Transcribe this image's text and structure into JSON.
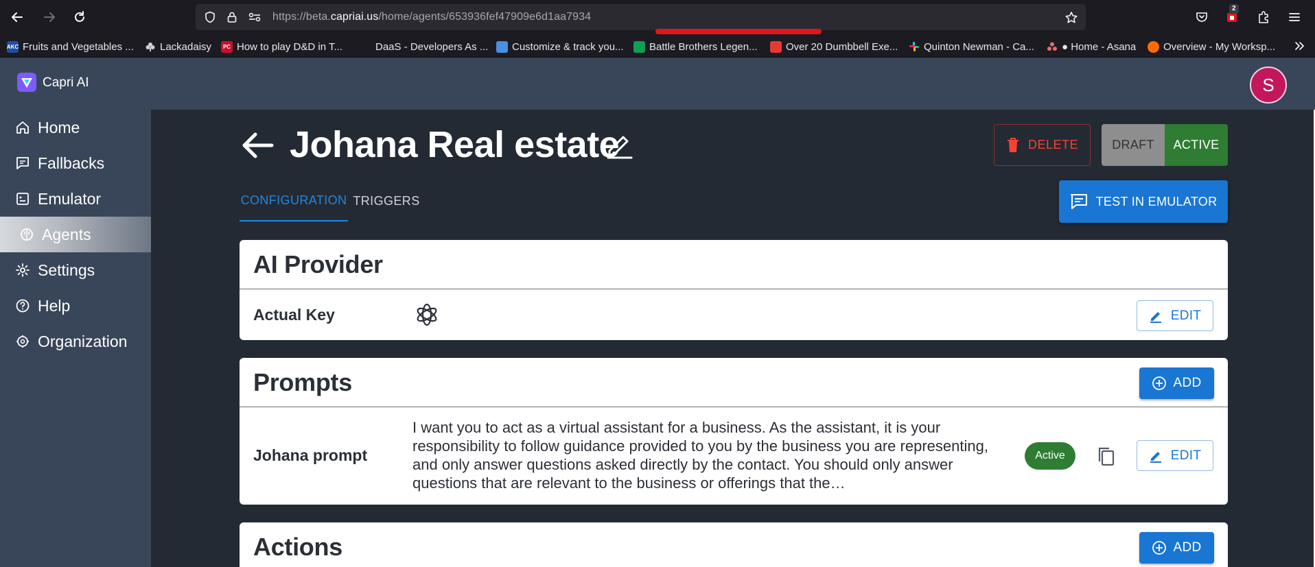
{
  "browser": {
    "url_prefix": "https://beta.",
    "url_host": "capriai.us",
    "url_path": "/home/agents/653936fef47909e6d1aa7934",
    "extension_badge": "2",
    "bookmarks": [
      {
        "label": "Fruits and Vegetables ...",
        "fav": "AKC",
        "color": "#1f4fa3"
      },
      {
        "label": "Lackadaisy",
        "fav": "",
        "color": "#1c1b22"
      },
      {
        "label": "How to play D&D in T...",
        "fav": "PC",
        "color": "#c8102e"
      },
      {
        "label": "DaaS - Developers As ...",
        "fav": "",
        "color": "#1c1b22"
      },
      {
        "label": "Customize & track you...",
        "fav": "",
        "color": "#4a90e2"
      },
      {
        "label": "Battle Brothers Legen...",
        "fav": "",
        "color": "#0f9d58"
      },
      {
        "label": "Over 20 Dumbbell Exe...",
        "fav": "",
        "color": "#e53935"
      },
      {
        "label": "Quinton Newman - Ca...",
        "fav": "",
        "color": "#611f69"
      },
      {
        "label": "● Home - Asana",
        "fav": "",
        "color": "#1c1b22"
      },
      {
        "label": "Overview - My Worksp...",
        "fav": "",
        "color": "#ff6d00"
      }
    ]
  },
  "app": {
    "brand": "Capri AI",
    "avatar_initial": "S"
  },
  "sidebar": {
    "items": [
      {
        "label": "Home",
        "icon": "home-icon"
      },
      {
        "label": "Fallbacks",
        "icon": "chat-icon"
      },
      {
        "label": "Emulator",
        "icon": "robot-icon"
      },
      {
        "label": "Agents",
        "icon": "brain-icon"
      },
      {
        "label": "Settings",
        "icon": "gear-icon"
      },
      {
        "label": "Help",
        "icon": "help-icon"
      },
      {
        "label": "Organization",
        "icon": "organization-icon"
      }
    ],
    "active": "Agents"
  },
  "page": {
    "title": "Johana Real estate",
    "delete_label": "DELETE",
    "status_options": [
      "DRAFT",
      "ACTIVE"
    ],
    "status_selected": "ACTIVE",
    "tabs": [
      "CONFIGURATION",
      "TRIGGERS"
    ],
    "selected_tab": "CONFIGURATION",
    "test_label": "TEST IN EMULATOR"
  },
  "ai_provider": {
    "title": "AI Provider",
    "key_label": "Actual Key",
    "provider_icon": "openai-icon",
    "edit_label": "EDIT"
  },
  "prompts": {
    "title": "Prompts",
    "add_label": "ADD",
    "items": [
      {
        "name": "Johana prompt",
        "text": "I want you to act as a virtual assistant for a business. As the assistant, it is your responsibility to follow guidance provided to you by the business you are representing, and only answer questions asked directly by the contact. You should only answer questions that are relevant to the business or offerings that the…",
        "status": "Active",
        "edit_label": "EDIT"
      }
    ]
  },
  "actions": {
    "title": "Actions",
    "add_label": "ADD"
  },
  "colors": {
    "primary": "#1976d2",
    "success": "#2e7d32",
    "danger": "#f44336",
    "sidebar": "#394659",
    "background": "#242a33"
  }
}
